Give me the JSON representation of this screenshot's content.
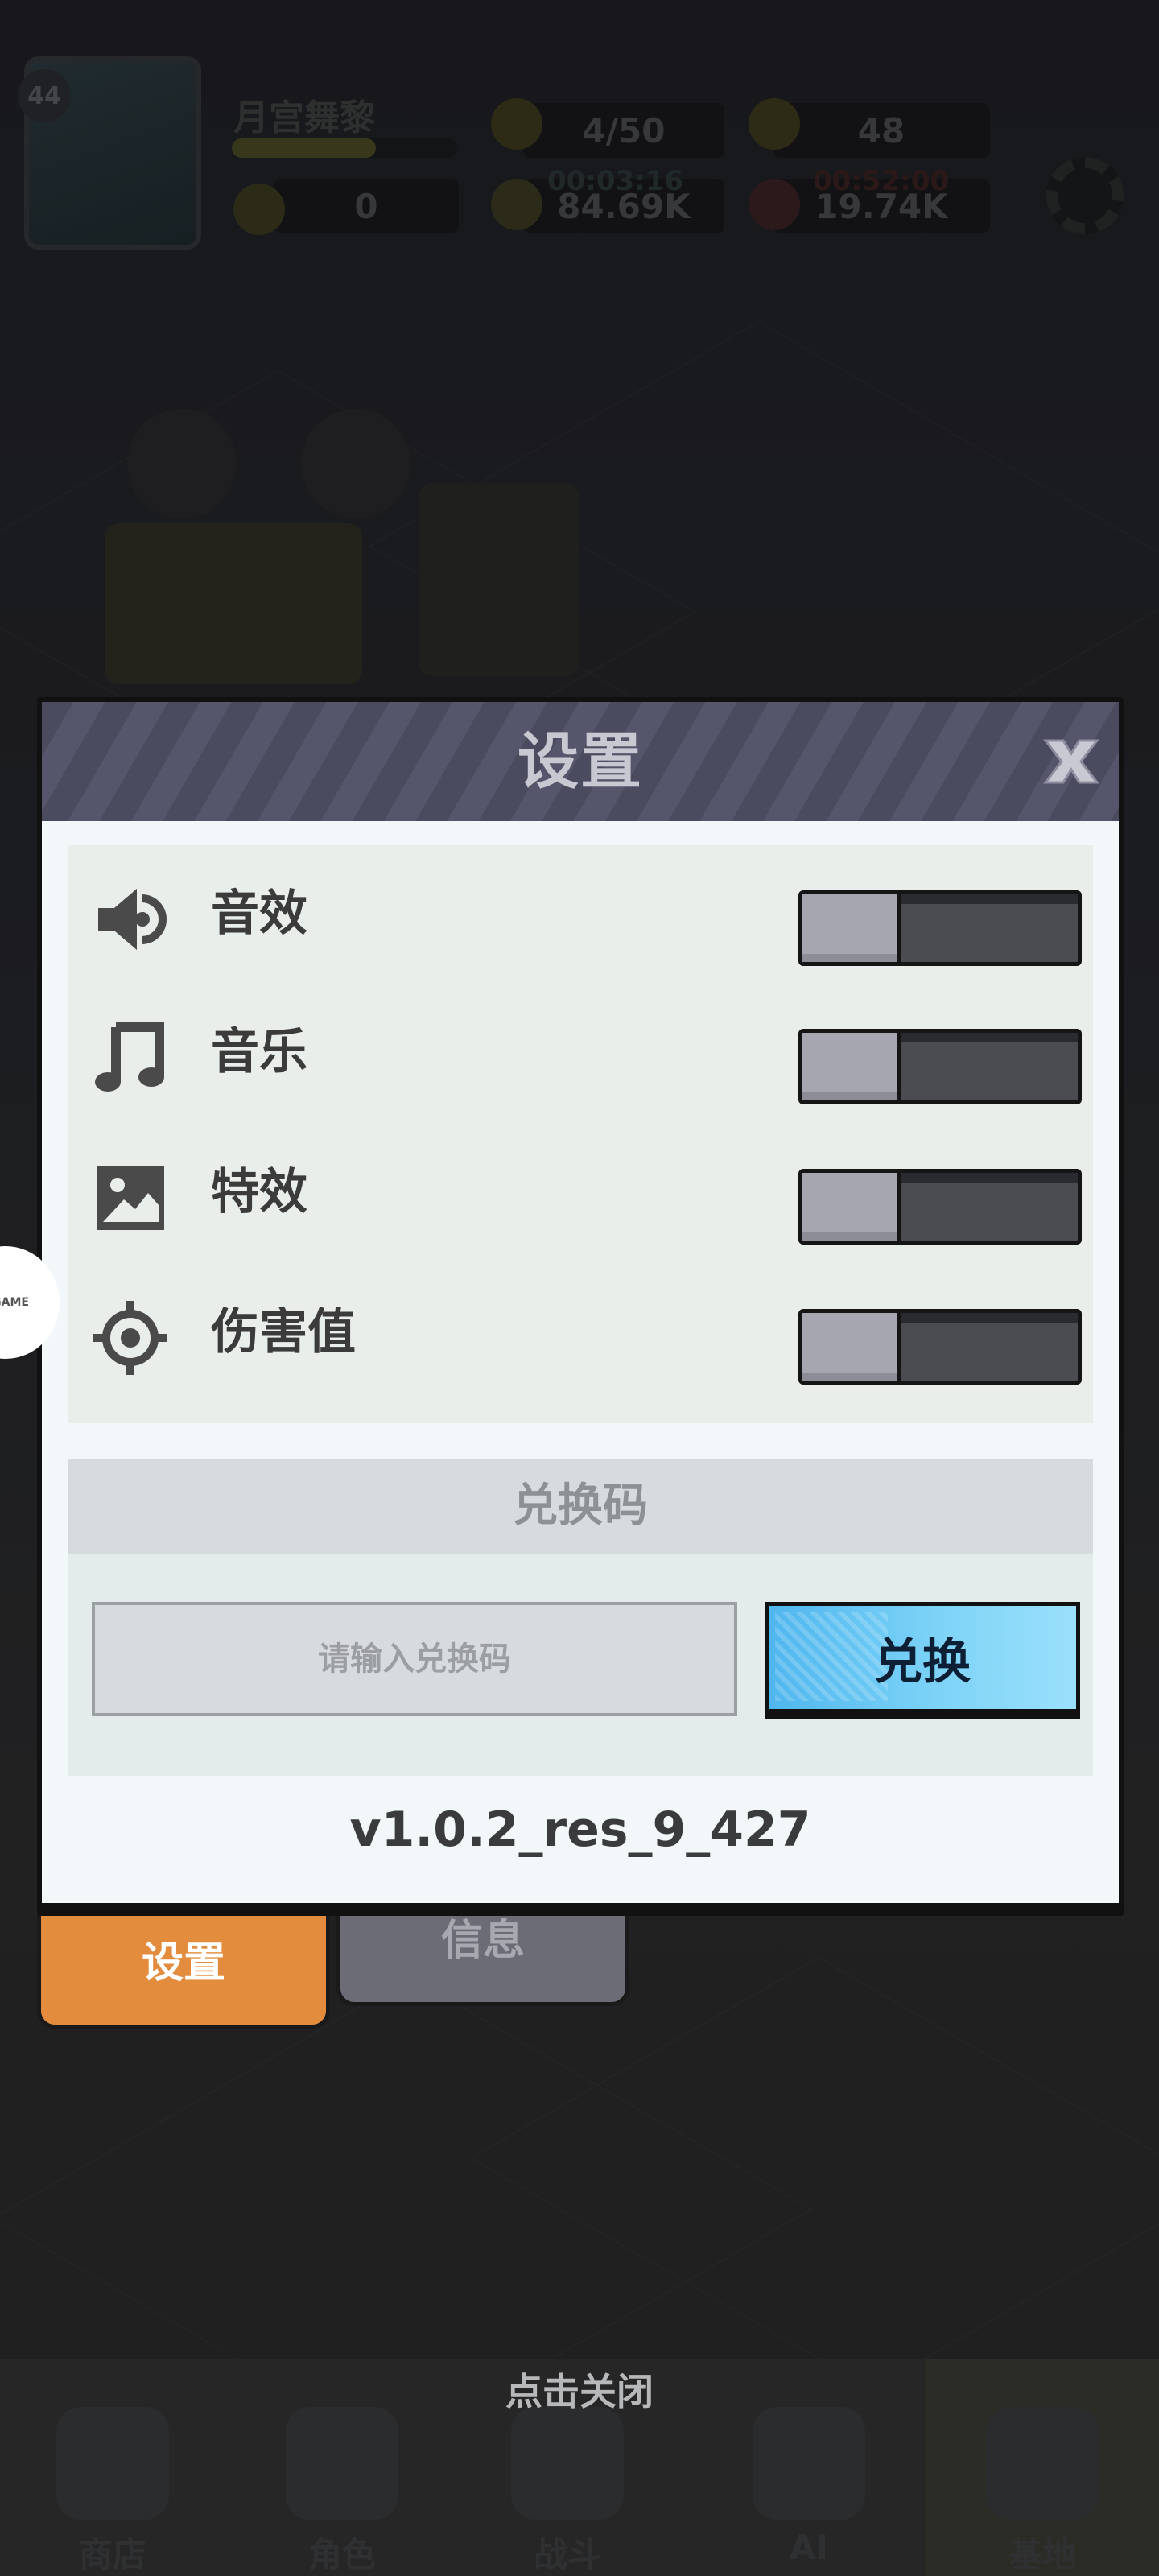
{
  "hud": {
    "level": "44",
    "player_name": "月宫舞黎",
    "xp_fraction": 0.64,
    "tickets": "0",
    "energy": "4/50",
    "energy_timer": "00:03:16",
    "gold": "84.69K",
    "gems": "48",
    "gems_timer": "00:52:00",
    "crystals": "19.74K"
  },
  "bottom_nav": {
    "items": [
      {
        "label": "商店"
      },
      {
        "label": "角色"
      },
      {
        "label": "战斗"
      },
      {
        "label": "AI"
      },
      {
        "label": "基地"
      }
    ]
  },
  "dialog": {
    "title": "设置",
    "options": [
      {
        "label": "音效",
        "icon": "speaker-icon",
        "enabled": false
      },
      {
        "label": "音乐",
        "icon": "music-note-icon",
        "enabled": false
      },
      {
        "label": "特效",
        "icon": "image-icon",
        "enabled": false
      },
      {
        "label": "伤害值",
        "icon": "crosshair-icon",
        "enabled": false
      }
    ],
    "redeem": {
      "header": "兑换码",
      "placeholder": "请输入兑换码",
      "button_label": "兑换"
    },
    "version": "v1.0.2_res_9_427"
  },
  "tabs": {
    "settings_label": "设置",
    "info_label": "信息"
  },
  "side_badge": "GAME",
  "tap_to_close": "点击关闭",
  "colors": {
    "accent_orange": "#e38c3e",
    "button_blue": "#7dd3f7",
    "header_purple": "#4b4b5f"
  }
}
